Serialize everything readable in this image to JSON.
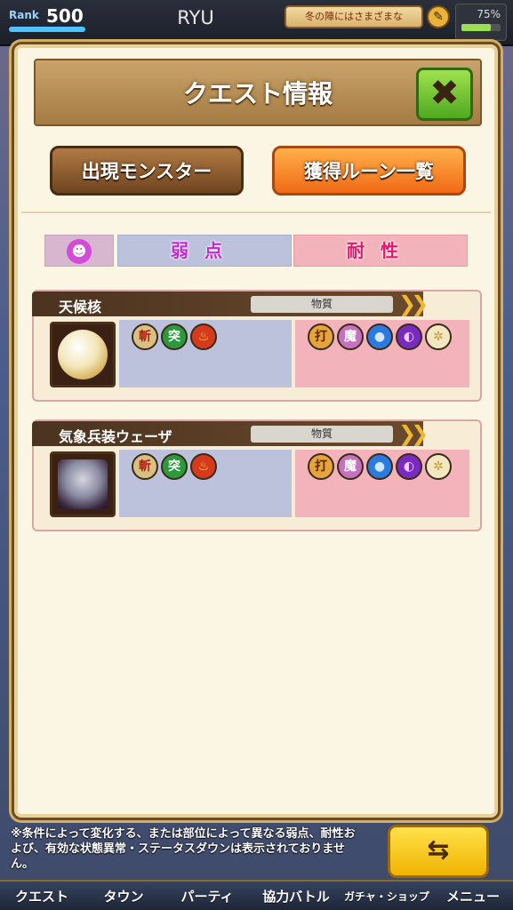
{
  "topbar": {
    "rank_label": "Rank",
    "rank_value": "500",
    "rank_progress": 1.0,
    "player_name": "RYU",
    "notice_text": "冬の陣にはさまざまな",
    "battery_percent": "75%",
    "battery_level": 0.75
  },
  "dialog": {
    "title": "クエスト情報",
    "close_icon": "✖",
    "tabs": [
      {
        "label": "出現モンスター"
      },
      {
        "label": "獲得ルーン一覧"
      }
    ],
    "legend": {
      "icon": "demon-face-icon",
      "weak_label": "弱点",
      "resist_label": "耐性"
    },
    "monsters": [
      {
        "name": "天候核",
        "type": "物質",
        "weak": [
          {
            "glyph": "斬",
            "icon": "slash-element-icon"
          },
          {
            "glyph": "突",
            "icon": "pierce-element-icon"
          },
          {
            "glyph": "♨",
            "icon": "fire-element-icon"
          }
        ],
        "resist": [
          {
            "glyph": "打",
            "icon": "strike-element-icon"
          },
          {
            "glyph": "魔",
            "icon": "magic-element-icon"
          },
          {
            "glyph": "●",
            "icon": "water-element-icon"
          },
          {
            "glyph": "◐",
            "icon": "dark-element-icon"
          },
          {
            "glyph": "✲",
            "icon": "light-element-icon"
          }
        ]
      },
      {
        "name": "気象兵装ウェーザ",
        "type": "物質",
        "weak": [
          {
            "glyph": "斬",
            "icon": "slash-element-icon"
          },
          {
            "glyph": "突",
            "icon": "pierce-element-icon"
          },
          {
            "glyph": "♨",
            "icon": "fire-element-icon"
          }
        ],
        "resist": [
          {
            "glyph": "打",
            "icon": "strike-element-icon"
          },
          {
            "glyph": "魔",
            "icon": "magic-element-icon"
          },
          {
            "glyph": "●",
            "icon": "water-element-icon"
          },
          {
            "glyph": "◐",
            "icon": "dark-element-icon"
          },
          {
            "glyph": "✲",
            "icon": "light-element-icon"
          }
        ]
      }
    ]
  },
  "footer": {
    "note": "※条件によって変化する、または部位によって異なる弱点、耐性および、有効な状態異常・ステータスダウンは表示されておりません。",
    "swap_icon": "⇆"
  },
  "nav": [
    {
      "label": "クエスト"
    },
    {
      "label": "タウン"
    },
    {
      "label": "パーティ"
    },
    {
      "label": "協力バトル"
    },
    {
      "label": "ガチャ・ショップ"
    },
    {
      "label": "メニュー"
    }
  ]
}
